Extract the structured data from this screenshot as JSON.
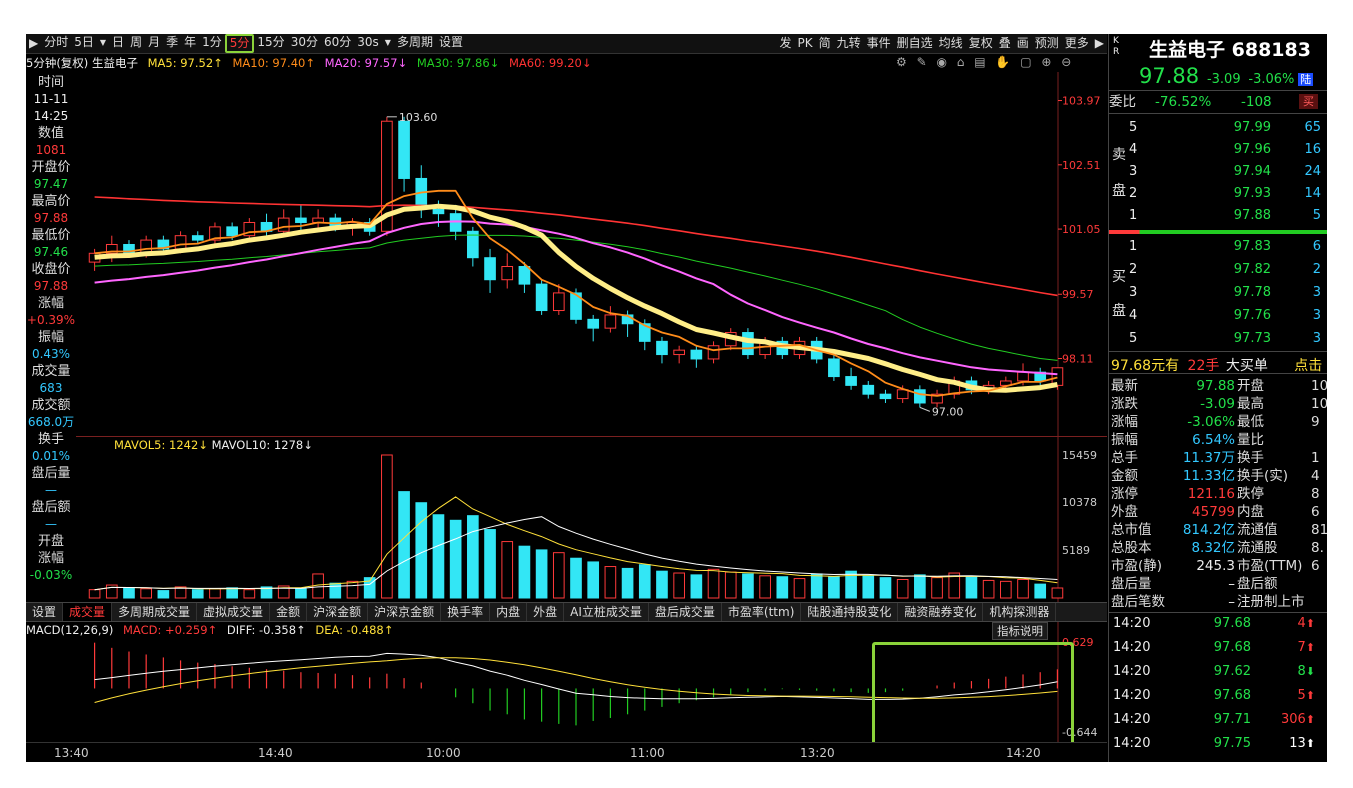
{
  "toolbar": {
    "items": [
      "分时",
      "5日",
      "日",
      "周",
      "月",
      "季",
      "年",
      "1分",
      "5分",
      "15分",
      "30分",
      "60分",
      "30s",
      "多周期",
      "设置"
    ],
    "active": "5分",
    "right_items": [
      "发",
      "PK",
      "简",
      "九转",
      "事件",
      "删自选",
      "均线",
      "复权",
      "叠",
      "画",
      "预测",
      "更多"
    ]
  },
  "legend": {
    "title": "5分钟(复权) 生益电子",
    "ma5": "MA5: 97.52↑",
    "ma10": "MA10: 97.40↑",
    "ma20": "MA20: 97.57↓",
    "ma30": "MA30: 97.86↓",
    "ma60": "MA60: 99.20↓"
  },
  "colors": {
    "ma5": "#ffffff",
    "ma10": "#ff8c1a",
    "ma20": "#ff66ff",
    "ma30": "#22cc22",
    "ma60": "#ff3333",
    "up": "#ff3a3a",
    "down": "#33e6f5",
    "accent": "#8bd33a"
  },
  "left_info": [
    {
      "k": "时间",
      "v": "11-11"
    },
    {
      "k": "",
      "v": "14:25"
    },
    {
      "k": "数值",
      "v": "1081"
    },
    {
      "k": "开盘价",
      "v": "97.47"
    },
    {
      "k": "最高价",
      "v": "97.88"
    },
    {
      "k": "最低价",
      "v": "97.46"
    },
    {
      "k": "收盘价",
      "v": "97.88"
    },
    {
      "k": "涨幅",
      "v": "+0.39%"
    },
    {
      "k": "振幅",
      "v": "0.43%"
    },
    {
      "k": "成交量",
      "v": "683"
    },
    {
      "k": "成交额",
      "v": "668.0万"
    },
    {
      "k": "换手",
      "v": "0.01%"
    },
    {
      "k": "盘后量",
      "v": "—"
    },
    {
      "k": "盘后额",
      "v": "—"
    },
    {
      "k": "开盘",
      "v": ""
    },
    {
      "k": "涨幅",
      "v": "-0.03%"
    }
  ],
  "price_axis": [
    "103.97",
    "102.51",
    "101.05",
    "99.57",
    "98.11"
  ],
  "high_label": "103.60",
  "low_label": "97.00",
  "volume": {
    "legend_mavol5": "MAVOL5: 1242↓",
    "legend_mavol10": "MAVOL10: 1278↓",
    "axis": [
      "15459",
      "10378",
      "5189"
    ]
  },
  "tabs": [
    "设置",
    "成交量",
    "多周期成交量",
    "虚拟成交量",
    "金额",
    "沪深金额",
    "沪深京金额",
    "换手率",
    "内盘",
    "外盘",
    "AI立桩成交量",
    "盘后成交量",
    "市盈率(ttm)",
    "陆股通持股变化",
    "融资融券变化",
    "机构探测器"
  ],
  "macd": {
    "title": "MACD(12,26,9)",
    "macd": "MACD: +0.259↑",
    "diff": "DIFF: -0.358↑",
    "dea": "DEA: -0.488↑",
    "axis_top": "0.629",
    "axis_bottom": "-0.644",
    "indicator_button": "指标说明"
  },
  "time_axis": [
    "13:40",
    "14:40",
    "10:00",
    "11:00",
    "13:20",
    "14:20"
  ],
  "quote": {
    "kr": "K R",
    "name": "生益电子",
    "code": "688183",
    "price": "97.88",
    "change": "-3.09",
    "pct": "-3.06%",
    "badge": "陆",
    "weibi_label": "委比",
    "weibi": "-76.52%",
    "weicha": "-108",
    "buy_btn": "买"
  },
  "asks": [
    {
      "lv": "5",
      "p": "97.99",
      "v": "65"
    },
    {
      "lv": "4",
      "p": "97.96",
      "v": "16"
    },
    {
      "lv": "3",
      "p": "97.94",
      "v": "24"
    },
    {
      "lv": "2",
      "p": "97.93",
      "v": "14"
    },
    {
      "lv": "1",
      "p": "97.88",
      "v": "5"
    }
  ],
  "bids": [
    {
      "lv": "1",
      "p": "97.83",
      "v": "6"
    },
    {
      "lv": "2",
      "p": "97.82",
      "v": "2"
    },
    {
      "lv": "3",
      "p": "97.78",
      "v": "3"
    },
    {
      "lv": "4",
      "p": "97.76",
      "v": "3"
    },
    {
      "lv": "5",
      "p": "97.73",
      "v": "3"
    }
  ],
  "ask_label": [
    "卖",
    "盘"
  ],
  "bid_label": [
    "买",
    "盘"
  ],
  "big_order": {
    "price": "97.68元有",
    "qty": "22手",
    "text": "大买单",
    "action": "点击"
  },
  "stats": [
    {
      "l1": "最新",
      "v1": "97.88",
      "l2": "开盘",
      "v2": "10"
    },
    {
      "l1": "涨跌",
      "v1": "-3.09",
      "l2": "最高",
      "v2": "10"
    },
    {
      "l1": "涨幅",
      "v1": "-3.06%",
      "l2": "最低",
      "v2": "9"
    },
    {
      "l1": "振幅",
      "v1": "6.54%",
      "l2": "量比",
      "v2": ""
    },
    {
      "l1": "总手",
      "v1": "11.37万",
      "l2": "换手",
      "v2": "1"
    },
    {
      "l1": "金额",
      "v1": "11.33亿",
      "l2": "换手(实)",
      "v2": "4"
    },
    {
      "l1": "涨停",
      "v1": "121.16",
      "l2": "跌停",
      "v2": "8"
    },
    {
      "l1": "外盘",
      "v1": "45799",
      "l2": "内盘",
      "v2": "6"
    },
    {
      "l1": "总市值",
      "v1": "814.2亿",
      "l2": "流通值",
      "v2": "81"
    },
    {
      "l1": "总股本",
      "v1": "8.32亿",
      "l2": "流通股",
      "v2": "8."
    },
    {
      "l1": "市盈(静)",
      "v1": "245.3",
      "l2": "市盈(TTM)",
      "v2": "6"
    },
    {
      "l1": "盘后量",
      "v1": "–",
      "l2": "盘后额",
      "v2": ""
    },
    {
      "l1": "盘后笔数",
      "v1": "–",
      "l2": "注册制上市",
      "v2": ""
    }
  ],
  "ticks": [
    {
      "t": "14:20",
      "p": "97.68",
      "q": "4",
      "d": "up"
    },
    {
      "t": "14:20",
      "p": "97.68",
      "q": "7",
      "d": "up"
    },
    {
      "t": "14:20",
      "p": "97.62",
      "q": "8",
      "d": "down"
    },
    {
      "t": "14:20",
      "p": "97.68",
      "q": "5",
      "d": "up"
    },
    {
      "t": "14:20",
      "p": "97.71",
      "q": "306",
      "d": "up"
    },
    {
      "t": "14:20",
      "p": "97.75",
      "q": "13",
      "d": "neutral"
    }
  ],
  "chart_data": {
    "type": "candlestick",
    "ylim": [
      96.6,
      104.3
    ],
    "candles": [
      [
        100.3,
        100.6,
        100.1,
        100.5
      ],
      [
        100.5,
        100.9,
        100.3,
        100.7
      ],
      [
        100.7,
        100.8,
        100.4,
        100.5
      ],
      [
        100.5,
        100.9,
        100.4,
        100.8
      ],
      [
        100.8,
        100.9,
        100.5,
        100.6
      ],
      [
        100.6,
        101.0,
        100.5,
        100.9
      ],
      [
        100.9,
        101.0,
        100.7,
        100.8
      ],
      [
        100.8,
        101.2,
        100.7,
        101.1
      ],
      [
        101.1,
        101.2,
        100.8,
        100.9
      ],
      [
        100.9,
        101.3,
        100.8,
        101.2
      ],
      [
        101.2,
        101.4,
        100.9,
        101.0
      ],
      [
        101.0,
        101.5,
        100.9,
        101.3
      ],
      [
        101.3,
        101.6,
        101.0,
        101.2
      ],
      [
        101.2,
        101.5,
        101.0,
        101.3
      ],
      [
        101.3,
        101.4,
        101.0,
        101.1
      ],
      [
        101.1,
        101.3,
        100.9,
        101.2
      ],
      [
        101.2,
        101.3,
        100.9,
        101.0
      ],
      [
        101.0,
        103.6,
        100.9,
        103.5
      ],
      [
        103.5,
        103.6,
        101.9,
        102.2
      ],
      [
        102.2,
        102.5,
        101.3,
        101.5
      ],
      [
        101.5,
        101.7,
        101.1,
        101.4
      ],
      [
        101.4,
        101.6,
        100.8,
        101.0
      ],
      [
        101.0,
        101.1,
        100.2,
        100.4
      ],
      [
        100.4,
        100.6,
        99.6,
        99.9
      ],
      [
        99.9,
        100.5,
        99.7,
        100.2
      ],
      [
        100.2,
        100.3,
        99.6,
        99.8
      ],
      [
        99.8,
        99.9,
        99.1,
        99.2
      ],
      [
        99.2,
        99.8,
        99.1,
        99.6
      ],
      [
        99.6,
        99.7,
        98.9,
        99.0
      ],
      [
        99.0,
        99.1,
        98.5,
        98.8
      ],
      [
        98.8,
        99.3,
        98.7,
        99.1
      ],
      [
        99.1,
        99.2,
        98.6,
        98.9
      ],
      [
        98.9,
        99.0,
        98.3,
        98.5
      ],
      [
        98.5,
        98.6,
        98.0,
        98.2
      ],
      [
        98.2,
        98.4,
        98.0,
        98.3
      ],
      [
        98.3,
        98.4,
        97.9,
        98.1
      ],
      [
        98.1,
        98.5,
        98.0,
        98.4
      ],
      [
        98.4,
        98.8,
        98.3,
        98.7
      ],
      [
        98.7,
        98.8,
        98.1,
        98.2
      ],
      [
        98.2,
        98.6,
        98.1,
        98.5
      ],
      [
        98.5,
        98.6,
        98.1,
        98.2
      ],
      [
        98.2,
        98.6,
        98.1,
        98.5
      ],
      [
        98.5,
        98.6,
        98.0,
        98.1
      ],
      [
        98.1,
        98.2,
        97.6,
        97.7
      ],
      [
        97.7,
        97.9,
        97.4,
        97.5
      ],
      [
        97.5,
        97.6,
        97.2,
        97.3
      ],
      [
        97.3,
        97.4,
        97.1,
        97.2
      ],
      [
        97.2,
        97.5,
        97.1,
        97.4
      ],
      [
        97.4,
        97.5,
        97.0,
        97.1
      ],
      [
        97.1,
        97.4,
        97.0,
        97.3
      ],
      [
        97.3,
        97.7,
        97.2,
        97.6
      ],
      [
        97.6,
        97.7,
        97.3,
        97.4
      ],
      [
        97.4,
        97.6,
        97.3,
        97.5
      ],
      [
        97.5,
        97.7,
        97.4,
        97.6
      ],
      [
        97.6,
        98.0,
        97.5,
        97.8
      ],
      [
        97.8,
        97.9,
        97.5,
        97.6
      ],
      [
        97.5,
        97.9,
        97.4,
        97.9
      ]
    ],
    "volumes": [
      900,
      1400,
      1100,
      1000,
      800,
      1200,
      900,
      1000,
      1100,
      900,
      1200,
      1300,
      1000,
      2600,
      1600,
      1800,
      2200,
      15459,
      11500,
      10300,
      9000,
      8400,
      8900,
      7400,
      6100,
      5600,
      5200,
      4900,
      4300,
      3900,
      3400,
      3200,
      3600,
      2900,
      2700,
      2500,
      3100,
      2800,
      2600,
      2400,
      2300,
      2100,
      2600,
      2300,
      2900,
      2400,
      2200,
      2000,
      2500,
      2200,
      2700,
      2300,
      1900,
      1800,
      2000,
      1500,
      1081
    ],
    "macd_hist": [
      0.62,
      0.55,
      0.5,
      0.46,
      0.42,
      0.38,
      0.35,
      0.33,
      0.3,
      0.28,
      0.26,
      0.24,
      0.22,
      0.21,
      0.2,
      0.18,
      0.15,
      0.2,
      0.14,
      0.08,
      0.0,
      -0.12,
      -0.2,
      -0.3,
      -0.35,
      -0.42,
      -0.45,
      -0.48,
      -0.5,
      -0.44,
      -0.4,
      -0.35,
      -0.3,
      -0.25,
      -0.2,
      -0.16,
      -0.12,
      -0.08,
      -0.05,
      -0.03,
      -0.01,
      -0.02,
      -0.03,
      -0.04,
      -0.05,
      -0.06,
      -0.05,
      -0.03,
      0.0,
      0.04,
      0.08,
      0.1,
      0.13,
      0.16,
      0.19,
      0.22,
      0.259
    ]
  }
}
